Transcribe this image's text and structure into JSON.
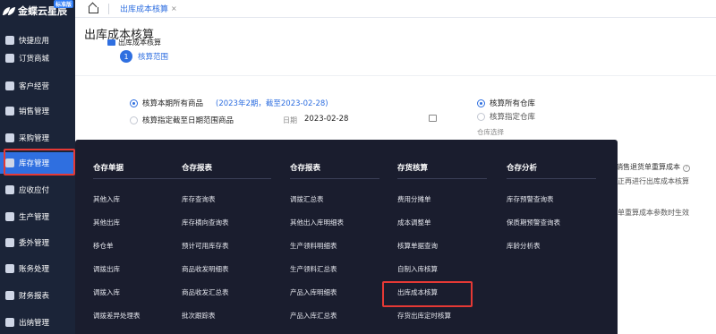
{
  "app": {
    "logo_text": "金蝶云星辰",
    "logo_badge": "标准版"
  },
  "sidebar": {
    "items": [
      {
        "label": "快捷应用",
        "icon": "grid-icon"
      },
      {
        "label": "订货商城",
        "icon": "store-icon"
      },
      {
        "label": "客户经营",
        "icon": "customer-icon"
      },
      {
        "label": "销售管理",
        "icon": "sales-icon"
      },
      {
        "label": "采购管理",
        "icon": "purchase-icon"
      },
      {
        "label": "库存管理",
        "icon": "inventory-icon"
      },
      {
        "label": "应收应付",
        "icon": "receivable-icon"
      },
      {
        "label": "生产管理",
        "icon": "production-icon"
      },
      {
        "label": "委外管理",
        "icon": "outsource-icon"
      },
      {
        "label": "账务处理",
        "icon": "ledger-icon"
      },
      {
        "label": "财务报表",
        "icon": "report-icon"
      },
      {
        "label": "出纳管理",
        "icon": "cashier-icon"
      }
    ]
  },
  "tabbar": {
    "current_tab": "出库成本核算",
    "close_glyph": "×"
  },
  "page": {
    "title": "出库成本核算",
    "subtitle": "出库成本核算",
    "step_number": "1",
    "step_label": "核算范围"
  },
  "options": {
    "scope_all": "核算本期所有商品",
    "scope_all_note": "(2023年2期，截至2023-02-28)",
    "scope_date": "核算指定截至日期范围商品",
    "date_label": "日期",
    "date_value": "2023-02-28",
    "wh_all": "核算所有仓库",
    "wh_specified": "核算指定仓库",
    "wh_select_label": "仓库选择"
  },
  "background_text": {
    "line1": "、销售退货单重算成本",
    "line2": "正再进行出库成本核算",
    "line3": "单重算成本参数时生效"
  },
  "mega_menu": {
    "columns": [
      {
        "title": "仓存单据",
        "items": [
          "其他入库",
          "其他出库",
          "移仓单",
          "调拨出库",
          "调拨入库",
          "调拨差异处理表"
        ]
      },
      {
        "title": "仓存报表",
        "items": [
          "库存查询表",
          "库存横向查询表",
          "预计可用库存表",
          "商品收发明细表",
          "商品收发汇总表",
          "批次跟踪表"
        ]
      },
      {
        "title": "仓存报表",
        "items": [
          "调拨汇总表",
          "其他出入库明细表",
          "生产领料明细表",
          "生产领料汇总表",
          "产品入库明细表",
          "产品入库汇总表"
        ]
      },
      {
        "title": "存货核算",
        "items": [
          "费用分摊单",
          "成本调整单",
          "核算单据查询",
          "自制入库核算",
          "出库成本核算",
          "存货出库定时核算"
        ]
      },
      {
        "title": "仓存分析",
        "items": [
          "库存预警查询表",
          "保质期预警查询表",
          "库龄分析表"
        ]
      }
    ]
  }
}
